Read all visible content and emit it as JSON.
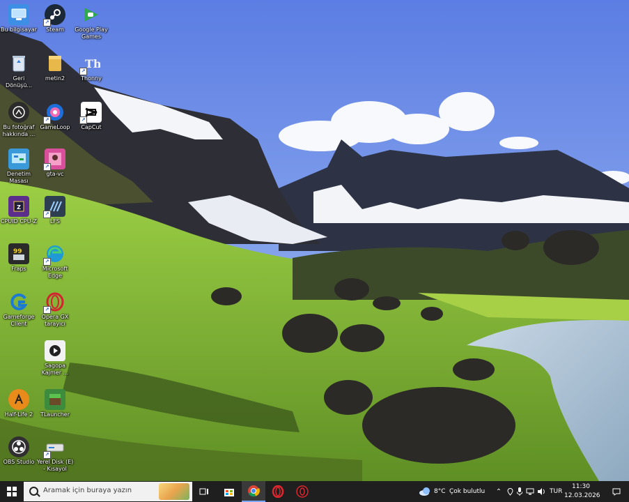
{
  "desktop": {
    "icons": [
      {
        "label": "Bu bilgisayar",
        "icon": "computer-icon",
        "color": "#3d8fe6"
      },
      {
        "label": "Steam",
        "icon": "steam-icon",
        "color": "#1b2838"
      },
      {
        "label": "Google Play Games",
        "icon": "google-play-games-icon",
        "color": "#2fa84f"
      },
      {
        "label": "Geri Dönüşü...",
        "icon": "recycle-bin-icon",
        "color": "#8aa4c0"
      },
      {
        "label": "metin2",
        "icon": "folder-icon",
        "color": "#e8b84a"
      },
      {
        "label": "Thonny",
        "icon": "thonny-icon",
        "color": "#f3f3f3"
      },
      {
        "label": "Bu fotoğraf hakkında ...",
        "icon": "camera-info-icon",
        "color": "#2b2b2b"
      },
      {
        "label": "GameLoop",
        "icon": "gameloop-icon",
        "color": "#1e6fd9"
      },
      {
        "label": "CapCut",
        "icon": "capcut-icon",
        "color": "#111111"
      },
      {
        "label": "Denetim Masası",
        "icon": "control-panel-icon",
        "color": "#3a9ad9"
      },
      {
        "label": "gta-vc",
        "icon": "gta-vc-icon",
        "color": "#d94f9c"
      },
      {
        "label": "CPUID CPU-Z",
        "icon": "cpu-z-icon",
        "color": "#5b2e8c"
      },
      {
        "label": "LFS",
        "icon": "lfs-icon",
        "color": "#2d3e50"
      },
      {
        "label": "Fraps",
        "icon": "fraps-icon",
        "color": "#e4c21c"
      },
      {
        "label": "Microsoft Edge",
        "icon": "edge-icon",
        "color": "#1f9ad6"
      },
      {
        "label": "Gameforge Client",
        "icon": "gameforge-icon",
        "color": "#1c7ad2"
      },
      {
        "label": "Opera GX tarayıcı",
        "icon": "opera-gx-icon",
        "color": "#d2232f"
      },
      {
        "label": "Sagopa Kajmer ...",
        "icon": "video-file-icon",
        "color": "#f2f2f2"
      },
      {
        "label": "Half-Life 2",
        "icon": "half-life-icon",
        "color": "#e88b1a"
      },
      {
        "label": "TLauncher",
        "icon": "tlauncher-icon",
        "color": "#3d8b3d"
      },
      {
        "label": "OBS Studio",
        "icon": "obs-icon",
        "color": "#302e31"
      },
      {
        "label": "Yerel Disk (E) - Kısayol",
        "icon": "drive-icon",
        "color": "#cfcfcf"
      }
    ]
  },
  "taskbar": {
    "search_placeholder": "Aramak için buraya yazın",
    "apps": [
      {
        "name": "task-view-icon"
      },
      {
        "name": "microsoft-store-icon"
      },
      {
        "name": "chrome-icon"
      },
      {
        "name": "opera-icon"
      },
      {
        "name": "opera-gx-icon"
      }
    ],
    "weather_temp": "8°C",
    "weather_text": "Çok bulutlu",
    "language": "TUR",
    "time": "11:30",
    "date": "12.03.2026"
  },
  "colors": {
    "taskbar_bg": "#1f1f1f",
    "sky": "#6d8cea",
    "grass": "#7fb83a"
  }
}
